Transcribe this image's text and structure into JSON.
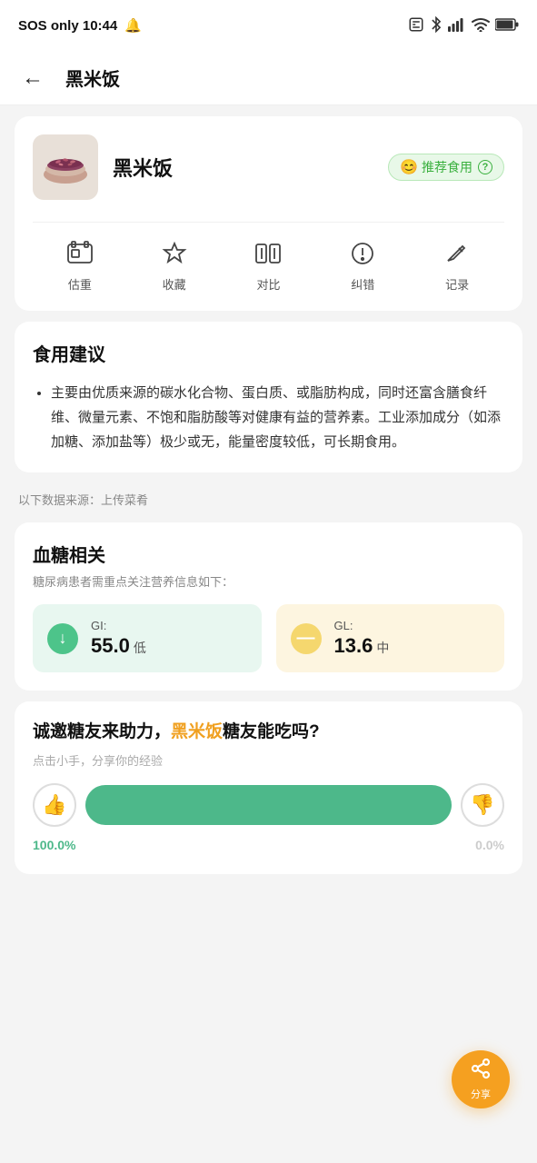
{
  "statusBar": {
    "left": "SOS only 10:44",
    "bell": "🔔",
    "nfc": "NFC",
    "bluetooth": "BT",
    "signal": "📶",
    "battery": "🔋"
  },
  "navBar": {
    "backLabel": "←",
    "title": "黑米饭"
  },
  "foodCard": {
    "name": "黑米饭",
    "badgeEmoji": "😊",
    "badgeText": "推荐食用",
    "helpHint": "?",
    "actions": [
      {
        "id": "estimate",
        "label": "估重",
        "icon": "image"
      },
      {
        "id": "collect",
        "label": "收藏",
        "icon": "star"
      },
      {
        "id": "compare",
        "label": "对比",
        "icon": "compare"
      },
      {
        "id": "correct",
        "label": "纠错",
        "icon": "error"
      },
      {
        "id": "record",
        "label": "记录",
        "icon": "edit"
      }
    ]
  },
  "advice": {
    "title": "食用建议",
    "items": [
      "主要由优质来源的碳水化合物、蛋白质、或脂肪构成，同时还富含膳食纤维、微量元素、不饱和脂肪酸等对健康有益的营养素。工业添加成分（如添加糖、添加盐等）极少或无，能量密度较低，可长期食用。"
    ]
  },
  "dataSource": {
    "text": "以下数据来源：上传菜肴"
  },
  "bloodSugar": {
    "title": "血糖相关",
    "subtitle": "糖尿病患者需重点关注营养信息如下：",
    "gi": {
      "label": "GI:",
      "value": "55.0",
      "level": "低"
    },
    "gl": {
      "label": "GL:",
      "value": "13.6",
      "level": "中"
    }
  },
  "community": {
    "title1": "诚邀糖友来助力，",
    "titleHighlight": "黑米饭",
    "title2": "糖友能吃吗?",
    "subtitle": "点击小手，分享你的经验",
    "thumbUpPercent": "100.0%",
    "thumbDownPercent": "0.0%"
  },
  "share": {
    "label": "分享"
  }
}
